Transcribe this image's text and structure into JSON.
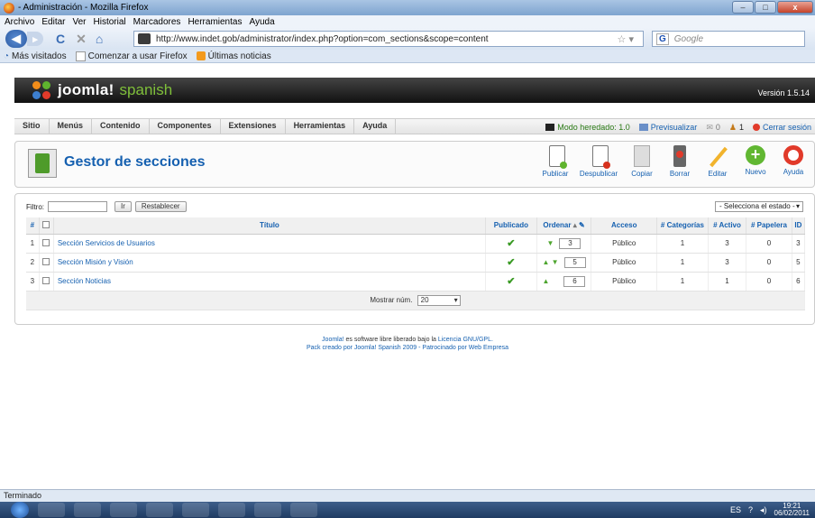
{
  "browser": {
    "window_title": "- Administración - Mozilla Firefox",
    "menu": [
      "Archivo",
      "Editar",
      "Ver",
      "Historial",
      "Marcadores",
      "Herramientas",
      "Ayuda"
    ],
    "url": "http://www.indet.gob/administrator/index.php?option=com_sections&scope=content",
    "search_placeholder": "Google",
    "bookmarks": [
      "Más visitados",
      "Comenzar a usar Firefox",
      "Últimas noticias"
    ],
    "status": "Terminado"
  },
  "joomla": {
    "logo_text": "joomla!",
    "logo_sub": "spanish",
    "version": "Versión 1.5.14",
    "menu": [
      "Sitio",
      "Menús",
      "Contenido",
      "Componentes",
      "Extensiones",
      "Herramientas",
      "Ayuda"
    ],
    "status": {
      "mode": "Modo heredado: 1.0",
      "preview": "Previsualizar",
      "messages": "0",
      "users": "1",
      "logout": "Cerrar sesión"
    }
  },
  "toolbar": {
    "title": "Gestor de secciones",
    "buttons": [
      "Publicar",
      "Despublicar",
      "Copiar",
      "Borrar",
      "Editar",
      "Nuevo",
      "Ayuda"
    ]
  },
  "filter": {
    "label": "Filtro:",
    "go_label": "Ir",
    "reset_label": "Restablecer",
    "state_select": "- Selecciona el estado -"
  },
  "table": {
    "headers": {
      "num": "#",
      "title": "Título",
      "published": "Publicado",
      "order": "Ordenar",
      "access": "Acceso",
      "categories": "# Categorías",
      "active": "# Activo",
      "trash": "# Papelera",
      "id": "ID"
    },
    "rows": [
      {
        "num": "1",
        "title": "Sección Servicios de Usuarios",
        "order": "3",
        "access": "Público",
        "categories": "1",
        "active": "3",
        "trash": "0",
        "id": "3"
      },
      {
        "num": "2",
        "title": "Sección Misión y Visión",
        "order": "5",
        "access": "Público",
        "categories": "1",
        "active": "3",
        "trash": "0",
        "id": "5"
      },
      {
        "num": "3",
        "title": "Sección Noticias",
        "order": "6",
        "access": "Público",
        "categories": "1",
        "active": "1",
        "trash": "0",
        "id": "6"
      }
    ],
    "pagination_label": "Mostrar núm.",
    "pagination_value": "20"
  },
  "credits": {
    "line1_link": "Joomla!",
    "line1_text": " es software libre liberado bajo la ",
    "line1_link2": "Licencia GNU/GPL.",
    "line2": "Pack creado por Joomla! Spanish 2009 - Patrocinado por Web Empresa"
  },
  "taskbar": {
    "lang": "ES",
    "time": "19:21",
    "date": "06/02/2011"
  }
}
